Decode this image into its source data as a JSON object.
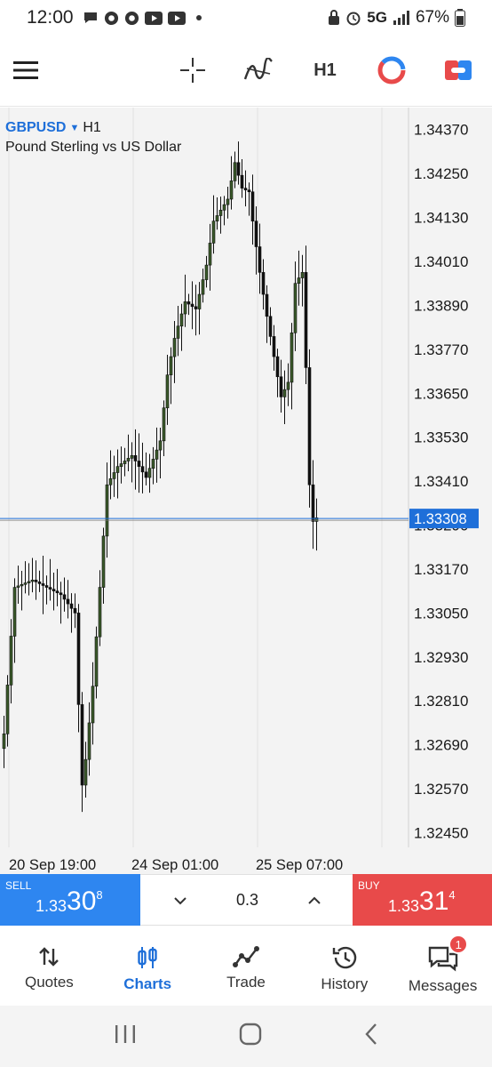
{
  "status_bar": {
    "time": "12:00",
    "network": "5G",
    "battery": "67%"
  },
  "toolbar": {
    "timeframe_label": "H1"
  },
  "chart": {
    "symbol": "GBPUSD",
    "timeframe": "H1",
    "description": "Pound Sterling vs US Dollar",
    "current_price_label": "1.33308"
  },
  "chart_data": {
    "type": "candlestick",
    "instrument": "GBPUSD",
    "timeframe": "H1",
    "y_ticks": [
      "1.34370",
      "1.34250",
      "1.34130",
      "1.34010",
      "1.33890",
      "1.33770",
      "1.33650",
      "1.33530",
      "1.33410",
      "1.33290",
      "1.33170",
      "1.33050",
      "1.32930",
      "1.32810",
      "1.32690",
      "1.32570",
      "1.32450"
    ],
    "ylim": [
      1.3241,
      1.3443
    ],
    "x_ticks": [
      "20 Sep 19:00",
      "24 Sep 01:00",
      "25 Sep 07:00"
    ],
    "current_price": 1.33308,
    "colors": {
      "up": "#3a5a2a",
      "down": "#111111",
      "price_line": "#1e6fd9",
      "grid": "#e2e2e2"
    }
  },
  "trade_panel": {
    "sell_label": "SELL",
    "sell_prefix": "1.33",
    "sell_big": "30",
    "sell_sup": "8",
    "volume": "0.3",
    "buy_label": "BUY",
    "buy_prefix": "1.33",
    "buy_big": "31",
    "buy_sup": "4"
  },
  "nav": {
    "quotes": "Quotes",
    "charts": "Charts",
    "trade": "Trade",
    "history": "History",
    "messages": "Messages",
    "messages_badge": "1"
  }
}
